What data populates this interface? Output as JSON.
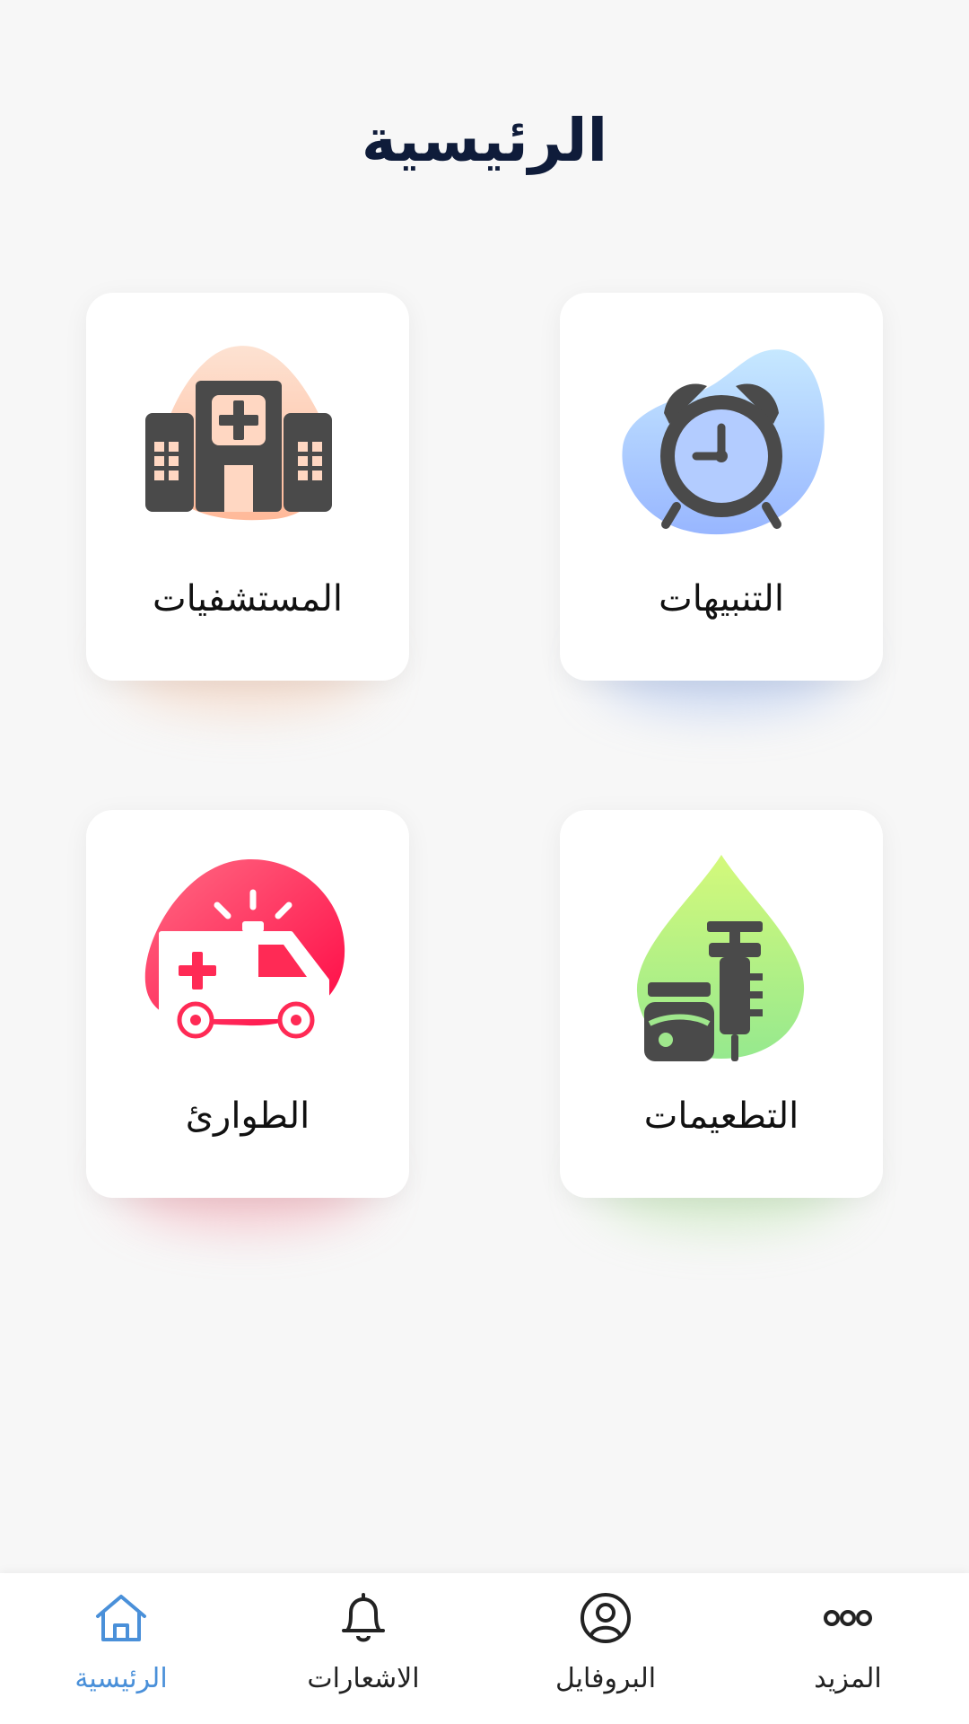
{
  "page": {
    "title": "الرئيسية"
  },
  "cards": [
    {
      "label": "المستشفيات",
      "icon": "hospital-icon",
      "blob_color": "#ffc9ae"
    },
    {
      "label": "التنبيهات",
      "icon": "alarm-clock-icon",
      "blob_color": "#a9c8ff"
    },
    {
      "label": "الطوارئ",
      "icon": "ambulance-icon",
      "blob_color": "#ff3b63"
    },
    {
      "label": "التطعيمات",
      "icon": "vaccine-icon",
      "blob_color": "#a6ef86"
    }
  ],
  "bottom_nav": {
    "items": [
      {
        "label": "المزيد",
        "icon": "more-icon",
        "active": false
      },
      {
        "label": "البروفايل",
        "icon": "profile-icon",
        "active": false
      },
      {
        "label": "الاشعارات",
        "icon": "bell-icon",
        "active": false
      },
      {
        "label": "الرئيسية",
        "icon": "home-icon",
        "active": true
      }
    ],
    "active_color": "#4a90d9"
  },
  "colors": {
    "background": "#f7f7f7",
    "title": "#0f1c3a",
    "icon_dark": "#4a4a4a"
  }
}
